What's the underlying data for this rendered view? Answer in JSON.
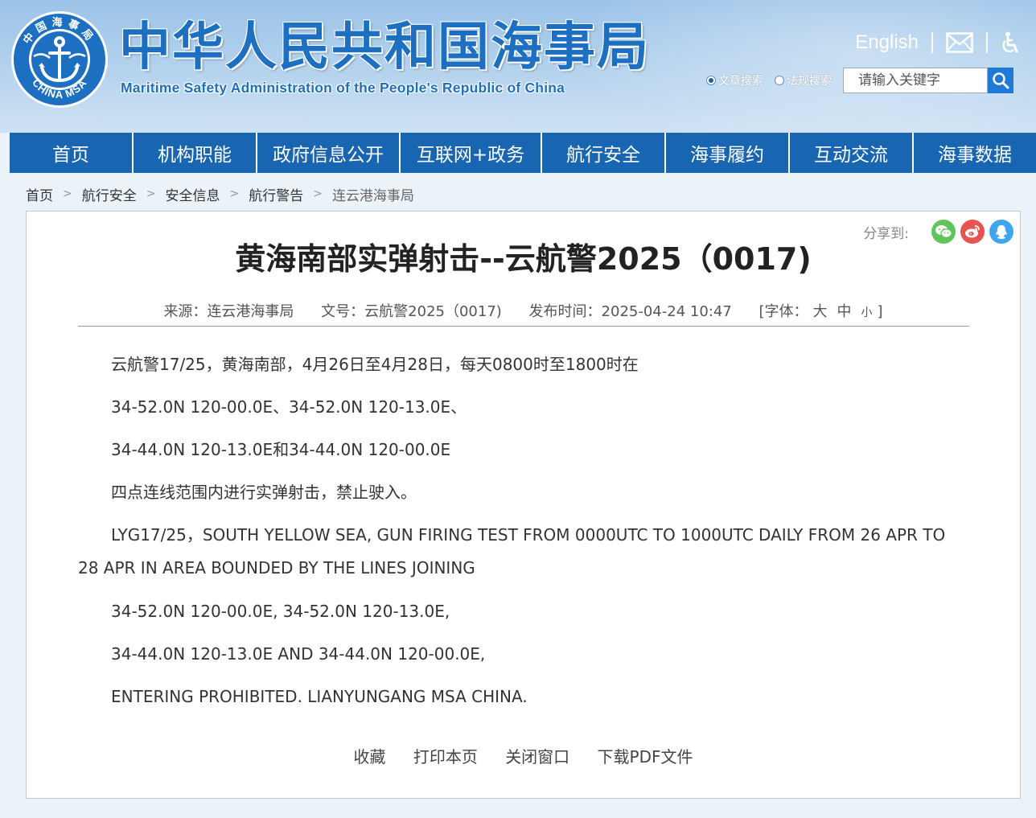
{
  "header": {
    "title_cn": "中华人民共和国海事局",
    "title_en": "Maritime Safety Administration of the People's Republic of China",
    "emblem_text_top": "中国海事局",
    "emblem_text_bottom": "CHINA MSA",
    "english_link": "English",
    "mail_icon": "mail-icon",
    "accessibility_icon": "accessibility-icon"
  },
  "search": {
    "options": [
      {
        "label": "文章搜索",
        "selected": true
      },
      {
        "label": "法规搜索",
        "selected": false
      }
    ],
    "placeholder": "请输入关键字",
    "button_icon": "search-icon"
  },
  "nav": {
    "items": [
      {
        "label": "首页"
      },
      {
        "label": "机构职能"
      },
      {
        "label": "政府信息公开"
      },
      {
        "label": "互联网+政务"
      },
      {
        "label": "航行安全"
      },
      {
        "label": "海事履约"
      },
      {
        "label": "互动交流"
      },
      {
        "label": "海事数据"
      }
    ]
  },
  "breadcrumb": {
    "separator": ">",
    "items": [
      "首页",
      "航行安全",
      "安全信息",
      "航行警告",
      "连云港海事局"
    ]
  },
  "share": {
    "label": "分享到:",
    "icons": [
      "wechat-icon",
      "weibo-icon",
      "qq-icon"
    ],
    "colors": {
      "wechat": "#5fc45a",
      "weibo": "#e9534f",
      "qq": "#3fa6ee"
    }
  },
  "article": {
    "title": "黄海南部实弹射击--云航警2025（0017)",
    "source": "来源：连云港海事局",
    "doc_no": "文号：云航警2025（0017)",
    "published": "发布时间：2025-04-24 10:47",
    "font_label": "[字体：",
    "font_large": "大",
    "font_medium": "中",
    "font_small": "小",
    "font_close": "]",
    "paragraphs": [
      "云航警17/25，黄海南部，4月26日至4月28日，每天0800时至1800时在",
      "34-52.0N 120-00.0E、34-52.0N 120-13.0E、",
      "34-44.0N 120-13.0E和34-44.0N 120-00.0E",
      "四点连线范围内进行实弹射击，禁止驶入。",
      "LYG17/25，SOUTH YELLOW SEA, GUN FIRING TEST FROM 0000UTC TO 1000UTC DAILY FROM 26 APR TO 28 APR IN AREA BOUNDED BY THE LINES JOINING",
      "34-52.0N 120-00.0E, 34-52.0N 120-13.0E,",
      "34-44.0N 120-13.0E AND 34-44.0N 120-00.0E,",
      "ENTERING PROHIBITED. LIANYUNGANG MSA CHINA."
    ]
  },
  "actions": {
    "favorite": "收藏",
    "print": "打印本页",
    "close": "关闭窗口",
    "download_pdf": "下载PDF文件"
  },
  "colors": {
    "nav_bg": "#1865b2",
    "brand_blue": "#1d6fc2",
    "search_btn": "#1f7ad6"
  }
}
